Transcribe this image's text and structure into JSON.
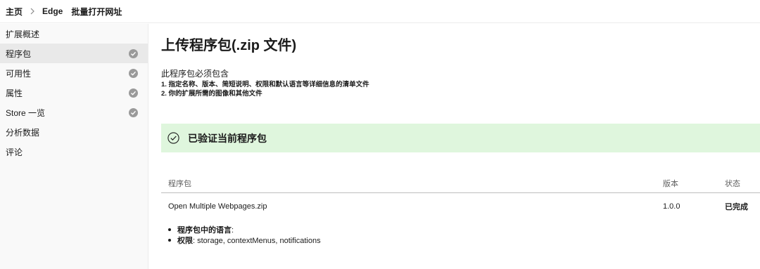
{
  "breadcrumb": {
    "home": "主页",
    "product": "Edge",
    "extension": "批量打开网址"
  },
  "sidebar": {
    "items": [
      {
        "label": "扩展概述",
        "checked": false,
        "active": false
      },
      {
        "label": "程序包",
        "checked": true,
        "active": true
      },
      {
        "label": "可用性",
        "checked": true,
        "active": false
      },
      {
        "label": "属性",
        "checked": true,
        "active": false
      },
      {
        "label": "Store 一览",
        "checked": true,
        "active": false
      },
      {
        "label": "分析数据",
        "checked": false,
        "active": false
      },
      {
        "label": "评论",
        "checked": false,
        "active": false
      }
    ]
  },
  "main": {
    "title": "上传程序包(.zip 文件)",
    "requirements_heading": "此程序包必须包含",
    "requirements": [
      "1. 指定名称、版本、简短说明、权限和默认语言等详细信息的清单文件",
      "2. 你的扩展所需的图像和其他文件"
    ],
    "banner": {
      "message": "已验证当前程序包",
      "color": "#dff6dd"
    },
    "table": {
      "headers": {
        "name": "程序包",
        "version": "版本",
        "status": "状态"
      },
      "rows": [
        {
          "name": "Open Multiple Webpages.zip",
          "version": "1.0.0",
          "status": "已完成"
        }
      ]
    },
    "details": {
      "languages_key": "程序包中的语言",
      "languages_value": ":",
      "permissions_key": "权限",
      "permissions_value": ": storage, contextMenus, notifications"
    }
  }
}
